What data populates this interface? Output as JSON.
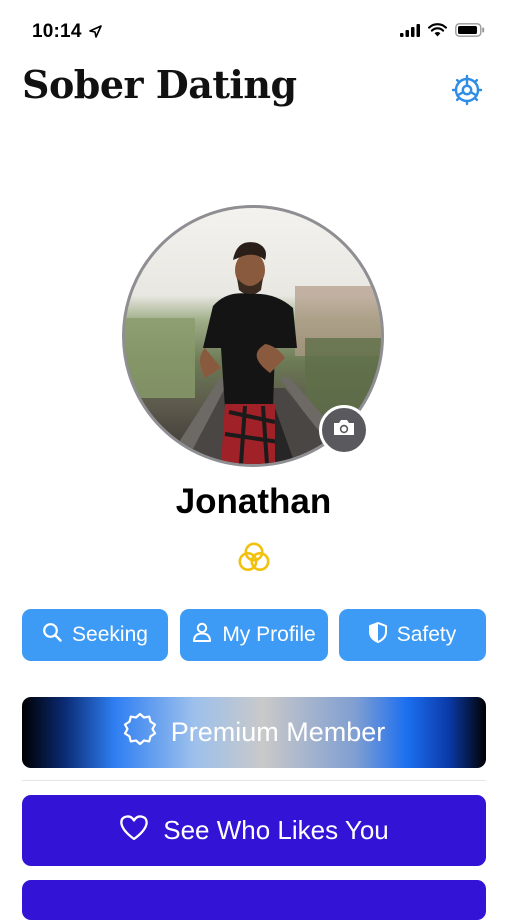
{
  "status_bar": {
    "time": "10:14",
    "icons": [
      "location-arrow-icon",
      "signal-icon",
      "wifi-icon",
      "battery-icon"
    ]
  },
  "header": {
    "title": "Sober Dating",
    "settings_icon": "gear-icon",
    "accent": "#2f8de4"
  },
  "profile": {
    "name": "Jonathan",
    "badge_icon": "three-rings-icon",
    "badge_color": "#f2c10f",
    "camera_icon": "camera-icon"
  },
  "nav": [
    {
      "label": "Seeking",
      "icon": "search-icon"
    },
    {
      "label": "My Profile",
      "icon": "person-icon"
    },
    {
      "label": "Safety",
      "icon": "shield-icon"
    }
  ],
  "premium": {
    "label": "Premium Member",
    "icon": "badge-seal-icon"
  },
  "likes": {
    "label": "See Who Likes You",
    "icon": "heart-icon"
  },
  "colors": {
    "nav_button": "#3e9bf5",
    "likes_button": "#3314d6"
  }
}
